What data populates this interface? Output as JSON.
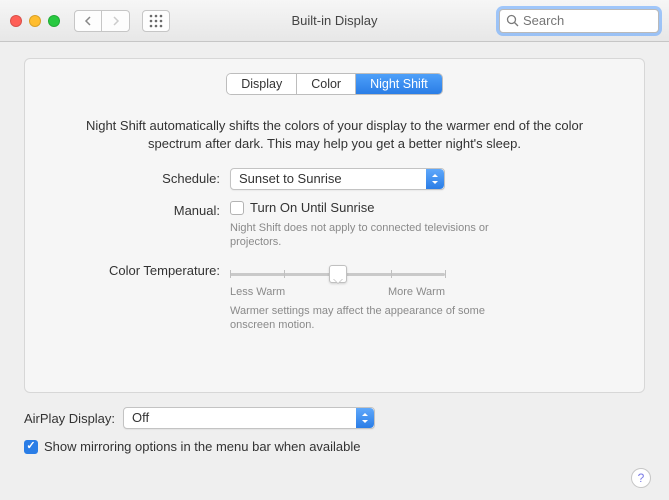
{
  "window": {
    "title": "Built-in Display",
    "search_placeholder": "Search"
  },
  "tabs": [
    "Display",
    "Color",
    "Night Shift"
  ],
  "active_tab": "Night Shift",
  "description": "Night Shift automatically shifts the colors of your display to the warmer end of the color spectrum after dark. This may help you get a better night's sleep.",
  "schedule": {
    "label": "Schedule:",
    "value": "Sunset to Sunrise"
  },
  "manual": {
    "label": "Manual:",
    "checkbox_label": "Turn On Until Sunrise",
    "checked": false,
    "note": "Night Shift does not apply to connected televisions or projectors."
  },
  "color_temp": {
    "label": "Color Temperature:",
    "min_label": "Less Warm",
    "max_label": "More Warm",
    "note": "Warmer settings may affect the appearance of some onscreen motion."
  },
  "airplay": {
    "label": "AirPlay Display:",
    "value": "Off"
  },
  "mirror": {
    "checked": true,
    "label": "Show mirroring options in the menu bar when available"
  },
  "help_label": "?"
}
